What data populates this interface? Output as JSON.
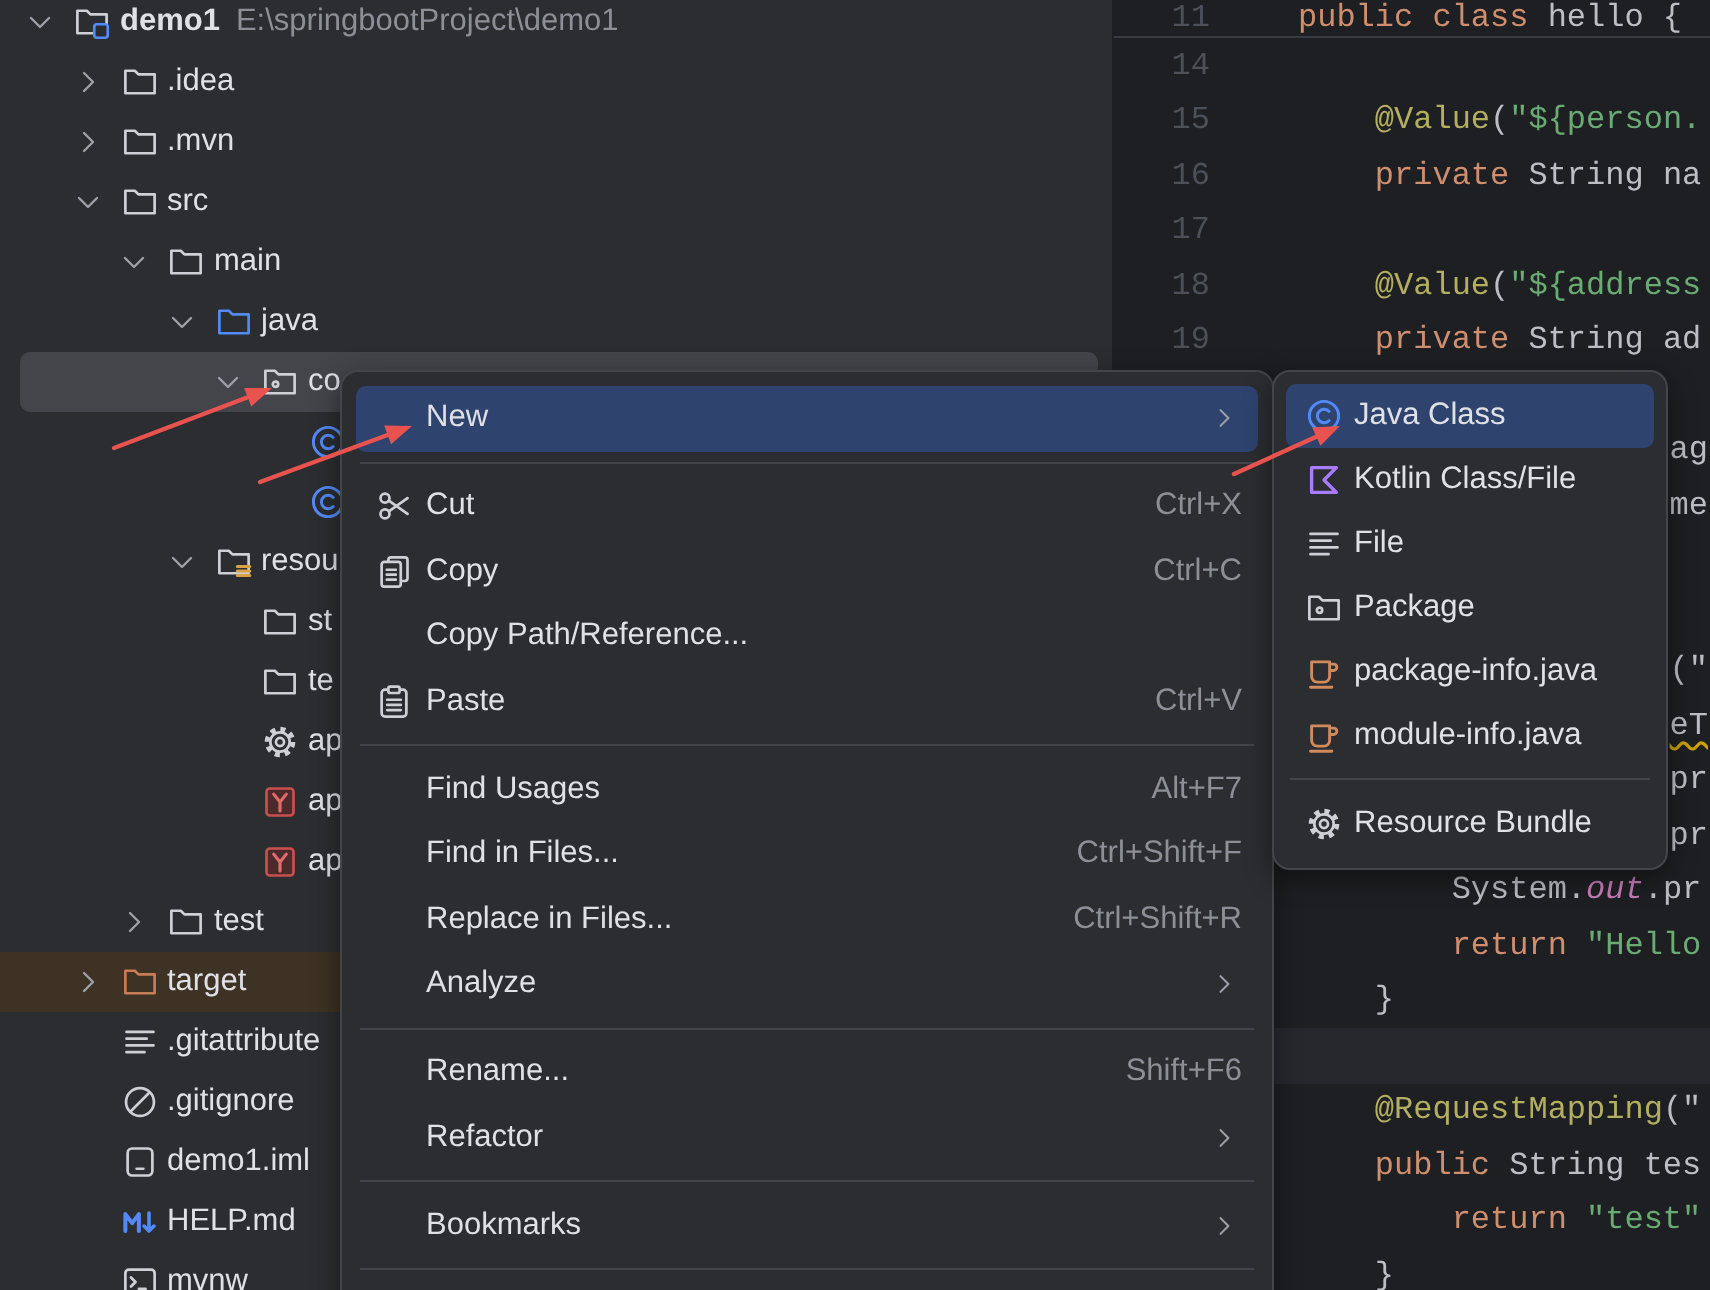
{
  "project_tree": {
    "label": "demo1",
    "path": "E:\\springbootProject\\demo1",
    "kind": "module",
    "expanded": true,
    "selected": false,
    "children": [
      {
        "label": ".idea",
        "kind": "folder",
        "expanded": false,
        "selected": false
      },
      {
        "label": ".mvn",
        "kind": "folder",
        "expanded": false,
        "selected": false
      },
      {
        "label": "src",
        "kind": "folder",
        "expanded": true,
        "selected": false,
        "children": [
          {
            "label": "main",
            "kind": "folder",
            "expanded": true,
            "selected": false,
            "children": [
              {
                "label": "java",
                "kind": "source-folder",
                "expanded": true,
                "selected": false,
                "children": [
                  {
                    "label": "co",
                    "kind": "package",
                    "expanded": true,
                    "selected": true,
                    "children": [
                      {
                        "kind": "class",
                        "selected": false
                      },
                      {
                        "kind": "class",
                        "selected": false
                      }
                    ]
                  }
                ]
              },
              {
                "label": "resou",
                "kind": "resources-folder",
                "expanded": true,
                "selected": false,
                "children": [
                  {
                    "label": "st",
                    "kind": "folder",
                    "selected": false
                  },
                  {
                    "label": "te",
                    "kind": "folder",
                    "selected": false
                  },
                  {
                    "label": "ap",
                    "kind": "properties",
                    "selected": false
                  },
                  {
                    "label": "ap",
                    "kind": "yaml",
                    "selected": false
                  },
                  {
                    "label": "ap",
                    "kind": "yaml",
                    "selected": false
                  }
                ]
              }
            ]
          },
          {
            "label": "test",
            "kind": "folder",
            "expanded": false,
            "selected": false
          }
        ]
      },
      {
        "label": "target",
        "kind": "excluded-folder",
        "expanded": false,
        "selected": false
      },
      {
        "label": ".gitattribute",
        "kind": "text-file",
        "selected": false
      },
      {
        "label": ".gitignore",
        "kind": "ignore-file",
        "selected": false
      },
      {
        "label": "demo1.iml",
        "kind": "module-file",
        "selected": false
      },
      {
        "label": "HELP.md",
        "kind": "markdown",
        "selected": false
      },
      {
        "label": "mvnw",
        "kind": "script",
        "selected": false
      }
    ]
  },
  "editor": {
    "sticky_line": {
      "number": "11",
      "tokens": [
        {
          "kind": "keyword",
          "text": "public class"
        },
        {
          "kind": "plain",
          "text": " hello {"
        }
      ]
    },
    "lines": [
      {
        "number": "14",
        "kind": "full",
        "current": false
      },
      {
        "number": "15",
        "kind": "full",
        "current": false,
        "tokens": [
          {
            "kind": "annotation",
            "text": "    @Value"
          },
          {
            "kind": "plain",
            "text": "("
          },
          {
            "kind": "string",
            "text": "\"${person."
          }
        ]
      },
      {
        "number": "16",
        "kind": "full",
        "current": false,
        "tokens": [
          {
            "kind": "keyword",
            "text": "    private"
          },
          {
            "kind": "plain",
            "text": " String na"
          }
        ]
      },
      {
        "number": "17",
        "kind": "full",
        "current": false
      },
      {
        "number": "18",
        "kind": "full",
        "current": false,
        "tokens": [
          {
            "kind": "annotation",
            "text": "    @Value"
          },
          {
            "kind": "plain",
            "text": "("
          },
          {
            "kind": "string",
            "text": "\"${address"
          }
        ]
      },
      {
        "number": "19",
        "kind": "full",
        "current": false,
        "tokens": [
          {
            "kind": "keyword",
            "text": "    private"
          },
          {
            "kind": "plain",
            "text": " String ad"
          }
        ]
      },
      {
        "kind": "full",
        "current": false
      },
      {
        "kind": "cut",
        "current": false,
        "tokens": [
          {
            "kind": "plain",
            "text": "ag"
          }
        ]
      },
      {
        "kind": "cut",
        "current": false,
        "tokens": [
          {
            "kind": "plain",
            "text": "me"
          }
        ]
      },
      {
        "kind": "full",
        "current": false
      },
      {
        "kind": "full",
        "current": false
      },
      {
        "kind": "cut",
        "current": false,
        "tokens": [
          {
            "kind": "plain",
            "text": "(\""
          }
        ]
      },
      {
        "kind": "cut",
        "current": false,
        "tokens": [
          {
            "kind": "warning",
            "text": "eT"
          }
        ]
      },
      {
        "kind": "cut",
        "current": false,
        "tokens": [
          {
            "kind": "plain",
            "text": "pr"
          }
        ]
      },
      {
        "kind": "cut",
        "current": false,
        "tokens": [
          {
            "kind": "plain",
            "text": "pr"
          }
        ]
      },
      {
        "kind": "full",
        "current": false,
        "tokens": [
          {
            "kind": "plain",
            "text": "        System."
          },
          {
            "kind": "field",
            "text": "out"
          },
          {
            "kind": "plain",
            "text": ".pr"
          }
        ]
      },
      {
        "kind": "full",
        "current": false,
        "tokens": [
          {
            "kind": "keyword",
            "text": "        return"
          },
          {
            "kind": "string",
            "text": " \"Hello"
          }
        ]
      },
      {
        "kind": "full",
        "current": false,
        "tokens": [
          {
            "kind": "plain",
            "text": "    }"
          }
        ]
      },
      {
        "kind": "full",
        "current": true
      },
      {
        "kind": "full",
        "current": false,
        "tokens": [
          {
            "kind": "annotation",
            "text": "    @RequestMapping"
          },
          {
            "kind": "plain",
            "text": "(\""
          }
        ]
      },
      {
        "kind": "full",
        "current": false,
        "tokens": [
          {
            "kind": "keyword",
            "text": "    public"
          },
          {
            "kind": "plain",
            "text": " String tes"
          }
        ]
      },
      {
        "kind": "full",
        "current": false,
        "tokens": [
          {
            "kind": "keyword",
            "text": "        return"
          },
          {
            "kind": "string",
            "text": " \"test\""
          }
        ]
      },
      {
        "kind": "full",
        "current": false,
        "tokens": [
          {
            "kind": "plain",
            "text": "    }"
          }
        ]
      }
    ]
  },
  "context_menu": {
    "items": [
      {
        "kind": "item",
        "label": "New",
        "submenu": true,
        "selected": true
      },
      {
        "kind": "separator"
      },
      {
        "kind": "item",
        "label": "Cut",
        "shortcut": "Ctrl+X",
        "submenu": false,
        "selected": false
      },
      {
        "kind": "item",
        "label": "Copy",
        "shortcut": "Ctrl+C",
        "submenu": false,
        "selected": false
      },
      {
        "kind": "item",
        "label": "Copy Path/Reference...",
        "submenu": false,
        "selected": false
      },
      {
        "kind": "item",
        "label": "Paste",
        "shortcut": "Ctrl+V",
        "submenu": false,
        "selected": false
      },
      {
        "kind": "separator"
      },
      {
        "kind": "item",
        "label": "Find Usages",
        "shortcut": "Alt+F7",
        "submenu": false,
        "selected": false
      },
      {
        "kind": "item",
        "label": "Find in Files...",
        "shortcut": "Ctrl+Shift+F",
        "submenu": false,
        "selected": false
      },
      {
        "kind": "item",
        "label": "Replace in Files...",
        "shortcut": "Ctrl+Shift+R",
        "submenu": false,
        "selected": false
      },
      {
        "kind": "item",
        "label": "Analyze",
        "submenu": true,
        "selected": false
      },
      {
        "kind": "separator"
      },
      {
        "kind": "item",
        "label": "Rename...",
        "shortcut": "Shift+F6",
        "submenu": false,
        "selected": false
      },
      {
        "kind": "item",
        "label": "Refactor",
        "submenu": true,
        "selected": false
      },
      {
        "kind": "separator"
      },
      {
        "kind": "item",
        "label": "Bookmarks",
        "submenu": true,
        "selected": false
      },
      {
        "kind": "separator"
      }
    ]
  },
  "submenu": {
    "items": [
      {
        "kind": "item",
        "label": "Java Class",
        "selected": true
      },
      {
        "kind": "item",
        "label": "Kotlin Class/File",
        "selected": false
      },
      {
        "kind": "item",
        "label": "File",
        "selected": false
      },
      {
        "kind": "item",
        "label": "Package",
        "selected": false
      },
      {
        "kind": "item",
        "label": "package-info.java",
        "selected": false
      },
      {
        "kind": "item",
        "label": "module-info.java",
        "selected": false
      },
      {
        "kind": "separator"
      },
      {
        "kind": "item",
        "label": "Resource Bundle",
        "selected": false
      }
    ]
  }
}
